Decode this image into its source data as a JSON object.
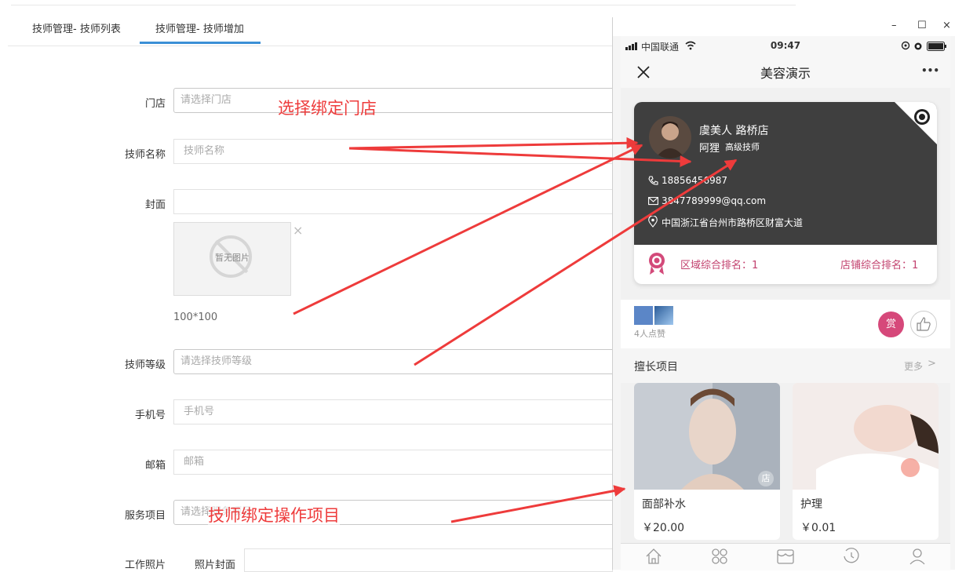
{
  "tabs": [
    "技师管理- 技师列表",
    "技师管理- 技师增加"
  ],
  "form": {
    "store_label": "门店",
    "store_placeholder": "请选择门店",
    "name_label": "技师名称",
    "name_placeholder": "技师名称",
    "cover_label": "封面",
    "no_image_text": "暂无图片",
    "remove_glyph": "×",
    "size_hint": "100*100",
    "level_label": "技师等级",
    "level_placeholder": "请选择技师等级",
    "phone_label": "手机号",
    "phone_placeholder": "手机号",
    "email_label": "邮箱",
    "email_placeholder": "邮箱",
    "service_label": "服务项目",
    "service_placeholder": "请选择服务项目",
    "work_photo_label": "工作照片",
    "photo_cover_label": "照片封面"
  },
  "annotations": {
    "store": "选择绑定门店",
    "service": "技师绑定操作项目"
  },
  "window": {
    "minimize": "–",
    "maximize": "☐",
    "close": "×"
  },
  "phone": {
    "carrier": "中国联通",
    "time": "09:47",
    "nav_title": "美容演示",
    "nav_more": "•••",
    "card": {
      "store": "虞美人 路桥店",
      "name": "阿狸",
      "level": "高级技师",
      "phone": "18856456987",
      "email": "3847789999@qq.com",
      "address": "中国浙江省台州市路桥区财富大道",
      "region_rank": "区域综合排名：1",
      "store_rank": "店铺综合排名：1"
    },
    "likes_text": "4人点赞",
    "reward": "赏",
    "section_title": "擅长项目",
    "more": "更多",
    "store_tag": "店",
    "projects": [
      {
        "name": "面部补水",
        "price": "￥20.00"
      },
      {
        "name": "护理",
        "price": "￥0.01"
      }
    ],
    "tab_icons": [
      "home-icon",
      "grid-icon",
      "shop-icon",
      "history-icon",
      "user-icon"
    ]
  },
  "colors": {
    "accent": "#3b8fd6",
    "annotation": "#ee3b3b",
    "rank": "#c2416e",
    "card_dark": "#3f3f3f"
  }
}
